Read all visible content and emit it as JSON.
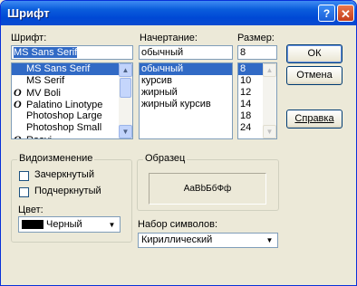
{
  "window": {
    "title": "Шрифт"
  },
  "titlebar": {
    "help_glyph": "?",
    "close_glyph": "✕"
  },
  "font": {
    "label": "Шрифт:",
    "value": "MS Sans Serif",
    "items": [
      {
        "icon": "",
        "label": "MS Sans Serif"
      },
      {
        "icon": "",
        "label": "MS Serif"
      },
      {
        "icon": "O",
        "label": "MV Boli"
      },
      {
        "icon": "O",
        "label": "Palatino Linotype"
      },
      {
        "icon": "",
        "label": "Photoshop Large"
      },
      {
        "icon": "",
        "label": "Photoshop Small"
      },
      {
        "icon": "O",
        "label": "Raavi"
      }
    ]
  },
  "style": {
    "label": "Начертание:",
    "value": "обычный",
    "items": [
      "обычный",
      "курсив",
      "жирный",
      "жирный курсив"
    ]
  },
  "size": {
    "label": "Размер:",
    "value": "8",
    "items": [
      "8",
      "10",
      "12",
      "14",
      "18",
      "24"
    ]
  },
  "buttons": {
    "ok": "ОК",
    "cancel": "Отмена",
    "help": "Справка"
  },
  "effects": {
    "title": "Видоизменение",
    "strikeout": "Зачеркнутый",
    "underline": "Подчеркнутый",
    "color_label": "Цвет:",
    "color_value": "Черный",
    "color_swatch": "#000000"
  },
  "sample": {
    "title": "Образец",
    "text": "AaBbБбФф"
  },
  "script": {
    "label": "Набор символов:",
    "value": "Кириллический"
  },
  "colors": {
    "titlebar": "#0a5ddc",
    "selection": "#316ac5"
  }
}
